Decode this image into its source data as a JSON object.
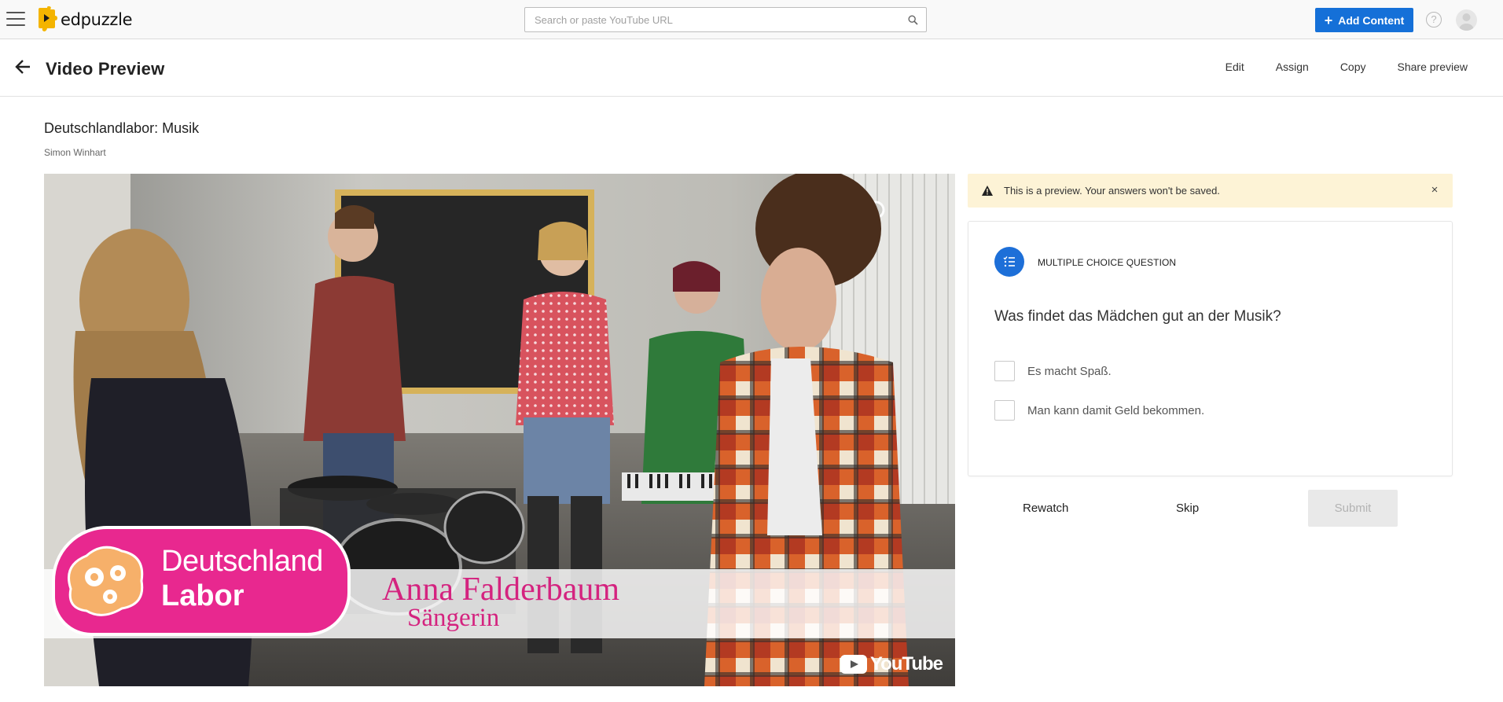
{
  "topbar": {
    "logo_text": "edpuzzle",
    "search_placeholder": "Search or paste YouTube URL",
    "add_content_label": "Add Content",
    "help_symbol": "?"
  },
  "header": {
    "title": "Video Preview",
    "actions": [
      "Edit",
      "Assign",
      "Copy",
      "Share preview"
    ]
  },
  "video": {
    "title": "Deutschlandlabor: Musik",
    "author": "Simon Winhart",
    "overlay": {
      "logo_line1": "Deutschland",
      "logo_line2": "Labor",
      "name": "Anna Falderbaum",
      "role": "Sängerin",
      "watermark": "YouTube"
    }
  },
  "notice": {
    "text": "This is a preview. Your answers won't be saved.",
    "close_symbol": "×"
  },
  "question": {
    "type_label": "MULTIPLE CHOICE QUESTION",
    "text": "Was findet das Mädchen gut an der Musik?",
    "options": [
      "Es macht Spaß.",
      "Man kann damit Geld bekommen."
    ]
  },
  "footer": {
    "rewatch_label": "Rewatch",
    "skip_label": "Skip",
    "submit_label": "Submit"
  },
  "colors": {
    "accent_blue": "#1570d8",
    "notice_bg": "#fdf3d6",
    "brand_pink": "#e8288f",
    "logo_yellow": "#f4b400"
  }
}
